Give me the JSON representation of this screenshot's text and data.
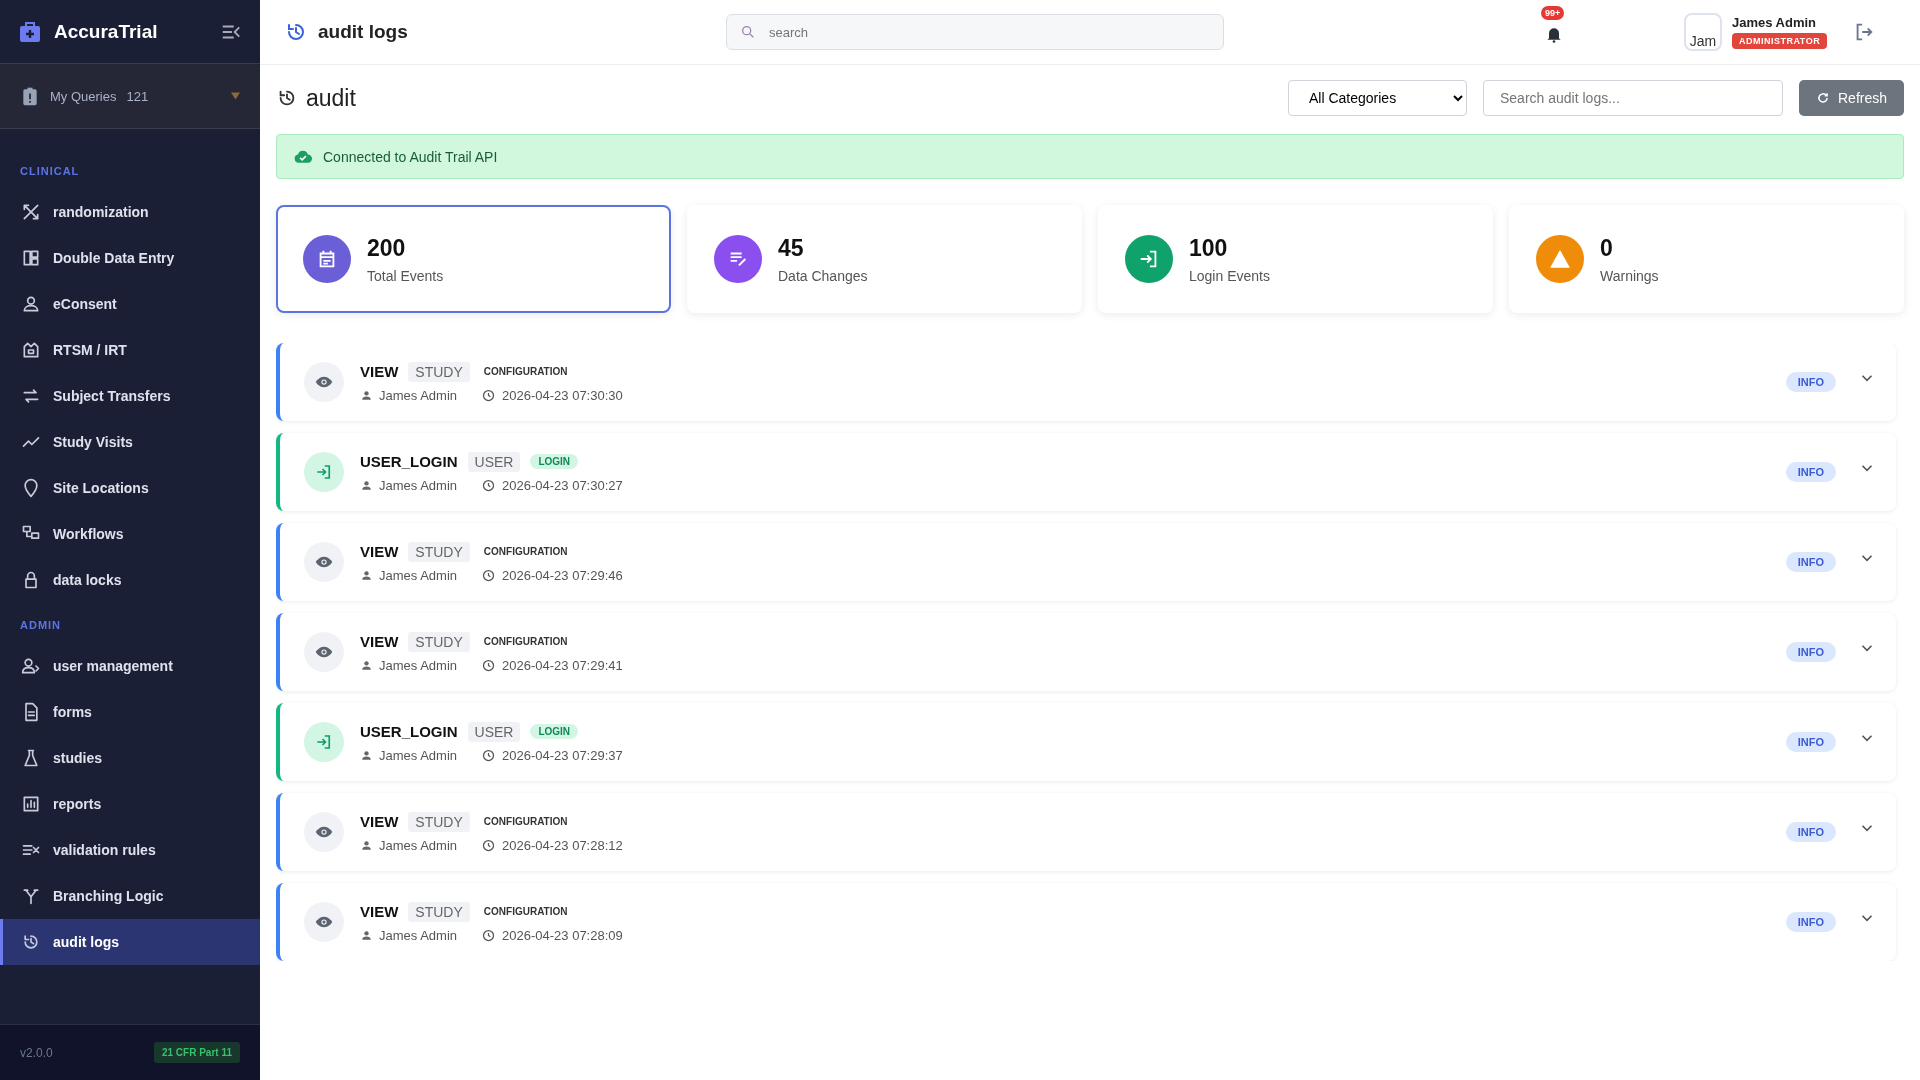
{
  "sidebar": {
    "brand": "AccuraTrial",
    "queries_panel": {
      "label": "My Queries",
      "count": "121",
      "expanded": false
    },
    "sections": [
      {
        "title": "CLINICAL",
        "items": [
          {
            "label": "randomization",
            "selected": false
          },
          {
            "label": "Double Data Entry",
            "selected": false
          },
          {
            "label": "eConsent",
            "selected": false
          },
          {
            "label": "RTSM / IRT",
            "selected": false
          },
          {
            "label": "Subject Transfers",
            "selected": false
          },
          {
            "label": "Study Visits",
            "selected": false
          },
          {
            "label": "Site Locations",
            "selected": false
          },
          {
            "label": "Workflows",
            "selected": false
          },
          {
            "label": "data locks",
            "selected": false
          }
        ]
      },
      {
        "title": "ADMIN",
        "items": [
          {
            "label": "user management",
            "selected": false
          },
          {
            "label": "forms",
            "selected": false
          },
          {
            "label": "studies",
            "selected": false
          },
          {
            "label": "reports",
            "selected": false
          },
          {
            "label": "validation rules",
            "selected": false
          },
          {
            "label": "Branching Logic",
            "selected": false
          },
          {
            "label": "audit logs",
            "selected": true
          }
        ]
      }
    ],
    "version": "v2.0.0",
    "compliance": "21 CFR Part 11"
  },
  "topbar": {
    "title": "audit logs",
    "search": {
      "placeholder": "search"
    },
    "notifications": "99+",
    "user": {
      "avatar_alt": "Jam",
      "name": "James Admin",
      "role": "ADMINISTRATOR"
    }
  },
  "page": {
    "title": "audit",
    "category": "All Categories",
    "search": {
      "placeholder": "Search audit logs..."
    },
    "refresh": "Refresh",
    "status": "Connected to Audit Trail API"
  },
  "stats": [
    {
      "value": "200",
      "label": "Total Events",
      "color": "#6a5fd6",
      "selected": true
    },
    {
      "value": "45",
      "label": "Data Changes",
      "color": "#8b4ff0",
      "selected": false
    },
    {
      "value": "100",
      "label": "Login Events",
      "color": "#10a26b",
      "selected": false
    },
    {
      "value": "0",
      "label": "Warnings",
      "color": "#ef8c0a",
      "selected": false
    }
  ],
  "logs": [
    {
      "kind": "view",
      "action": "VIEW",
      "entity": "STUDY",
      "category": "CONFIGURATION",
      "user": "James Admin",
      "time": "2026-04-23 07:30:30",
      "severity": "INFO",
      "expanded": false
    },
    {
      "kind": "login",
      "action": "USER_LOGIN",
      "entity": "USER",
      "category": "LOGIN",
      "user": "James Admin",
      "time": "2026-04-23 07:30:27",
      "severity": "INFO",
      "expanded": false
    },
    {
      "kind": "view",
      "action": "VIEW",
      "entity": "STUDY",
      "category": "CONFIGURATION",
      "user": "James Admin",
      "time": "2026-04-23 07:29:46",
      "severity": "INFO",
      "expanded": false
    },
    {
      "kind": "view",
      "action": "VIEW",
      "entity": "STUDY",
      "category": "CONFIGURATION",
      "user": "James Admin",
      "time": "2026-04-23 07:29:41",
      "severity": "INFO",
      "expanded": false
    },
    {
      "kind": "login",
      "action": "USER_LOGIN",
      "entity": "USER",
      "category": "LOGIN",
      "user": "James Admin",
      "time": "2026-04-23 07:29:37",
      "severity": "INFO",
      "expanded": false
    },
    {
      "kind": "view",
      "action": "VIEW",
      "entity": "STUDY",
      "category": "CONFIGURATION",
      "user": "James Admin",
      "time": "2026-04-23 07:28:12",
      "severity": "INFO",
      "expanded": false
    },
    {
      "kind": "view",
      "action": "VIEW",
      "entity": "STUDY",
      "category": "CONFIGURATION",
      "user": "James Admin",
      "time": "2026-04-23 07:28:09",
      "severity": "INFO",
      "expanded": false
    }
  ]
}
